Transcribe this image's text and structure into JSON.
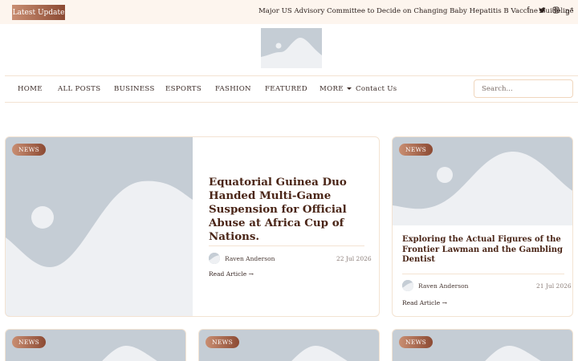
{
  "topbar": {
    "latest_label": "Latest Update",
    "ticker_text": "Major US Advisory Committee to Decide on Changing Baby Hepatitis B Vaccine Guideline",
    "social_icons": [
      "facebook-icon",
      "twitter-icon",
      "instagram-icon",
      "google-plus-icon"
    ]
  },
  "nav": {
    "items": [
      "HOME",
      "ALL POSTS",
      "BUSINESS",
      "ESPORTS",
      "FASHION",
      "FEATURED",
      "MORE",
      "Contact Us"
    ],
    "search_placeholder": "Search..."
  },
  "featured": {
    "badge": "NEWS",
    "title": "Equatorial Guinea Duo Handed Multi-Game Suspension for Official Abuse at Africa Cup of Nations.",
    "author": "Raven Anderson",
    "date": "22 Jul 2026",
    "read_more": "Read Article →"
  },
  "side_card": {
    "badge": "NEWS",
    "title": "Exploring the Actual Figures of the Frontier Lawman and the Gambling Dentist",
    "author": "Raven Anderson",
    "date": "21 Jul 2026",
    "read_more": "Read Article →"
  },
  "bottom_cards": [
    {
      "badge": "NEWS"
    },
    {
      "badge": "NEWS"
    },
    {
      "badge": "NEWS"
    }
  ],
  "colors": {
    "accent_start": "#c98e72",
    "accent_end": "#8c4a33",
    "title_color": "#4a2517",
    "placeholder": "#c5cdd5"
  }
}
